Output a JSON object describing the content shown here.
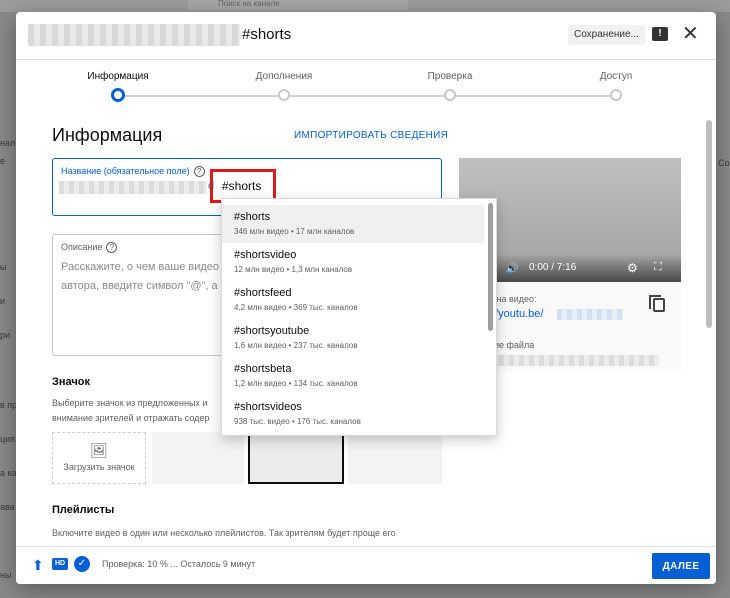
{
  "background": {
    "search_placeholder": "Поиск на канале",
    "left_fragments": [
      "ы",
      "нал",
      "е",
      "ы",
      "и",
      "ри",
      "в пр",
      "ция",
      "а ка",
      "ава",
      "ны"
    ],
    "right_fragments": [
      "Сохр"
    ]
  },
  "header": {
    "title_suffix": "#shorts",
    "saving_label": "Сохранение...",
    "report_icon": "feedback-icon",
    "close_icon": "close-icon"
  },
  "stepper": {
    "steps": [
      {
        "label": "Информация",
        "active": true
      },
      {
        "label": "Дополнения",
        "active": false
      },
      {
        "label": "Проверка",
        "active": false
      },
      {
        "label": "Доступ",
        "active": false
      }
    ]
  },
  "details": {
    "section_title": "Информация",
    "import_link": "ИМПОРТИРОВАТЬ СВЕДЕНИЯ",
    "title_field": {
      "label": "Название (обязательное поле)",
      "value_prefix": "d",
      "value_hashtag": "#shorts"
    },
    "description_field": {
      "label": "Описание",
      "placeholder_line1": "Расскажите, о чем ваше видео",
      "placeholder_line2": "автора, введите символ \"@\", а з"
    },
    "thumbnail": {
      "title": "Значок",
      "text_line1": "Выберите значок из предложенных и",
      "text_line2": "внимание зрителей и отражать содер",
      "upload_label": "Загрузить значок"
    },
    "playlists": {
      "title": "Плейлисты",
      "text_line1": "Включите видео в один или несколько плейлистов. Так зрителям будет проще его"
    }
  },
  "autocomplete": {
    "items": [
      {
        "tag": "#shorts",
        "meta": "346 млн видео • 17 млн каналов",
        "highlighted": true
      },
      {
        "tag": "#shortsvideo",
        "meta": "12 млн видео • 1,3 млн каналов",
        "highlighted": false
      },
      {
        "tag": "#shortsfeed",
        "meta": "4,2 млн видео • 369 тыс. каналов",
        "highlighted": false
      },
      {
        "tag": "#shortsyoutube",
        "meta": "1,6 млн видео • 237 тыс. каналов",
        "highlighted": false
      },
      {
        "tag": "#shortsbeta",
        "meta": "1,2 млн видео • 134 тыс. каналов",
        "highlighted": false
      },
      {
        "tag": "#shortsvideos",
        "meta": "938 тыс. видео • 176 тыс. каналов",
        "highlighted": false
      }
    ]
  },
  "video": {
    "time": "0:00 / 7:16",
    "link_label": "а на видео:",
    "link_text": "://youtu.be/",
    "file_label": "ние файла",
    "icons": [
      "volume-icon",
      "settings-icon",
      "fullscreen-icon",
      "copy-icon"
    ]
  },
  "footer": {
    "status": "Проверка: 10 % ... Осталось 9 минут",
    "next_label": "ДАЛЕЕ",
    "hd_label": "HD"
  },
  "colors": {
    "accent": "#065fd4",
    "highlight_box": "#e01818",
    "text_secondary": "#606060"
  }
}
